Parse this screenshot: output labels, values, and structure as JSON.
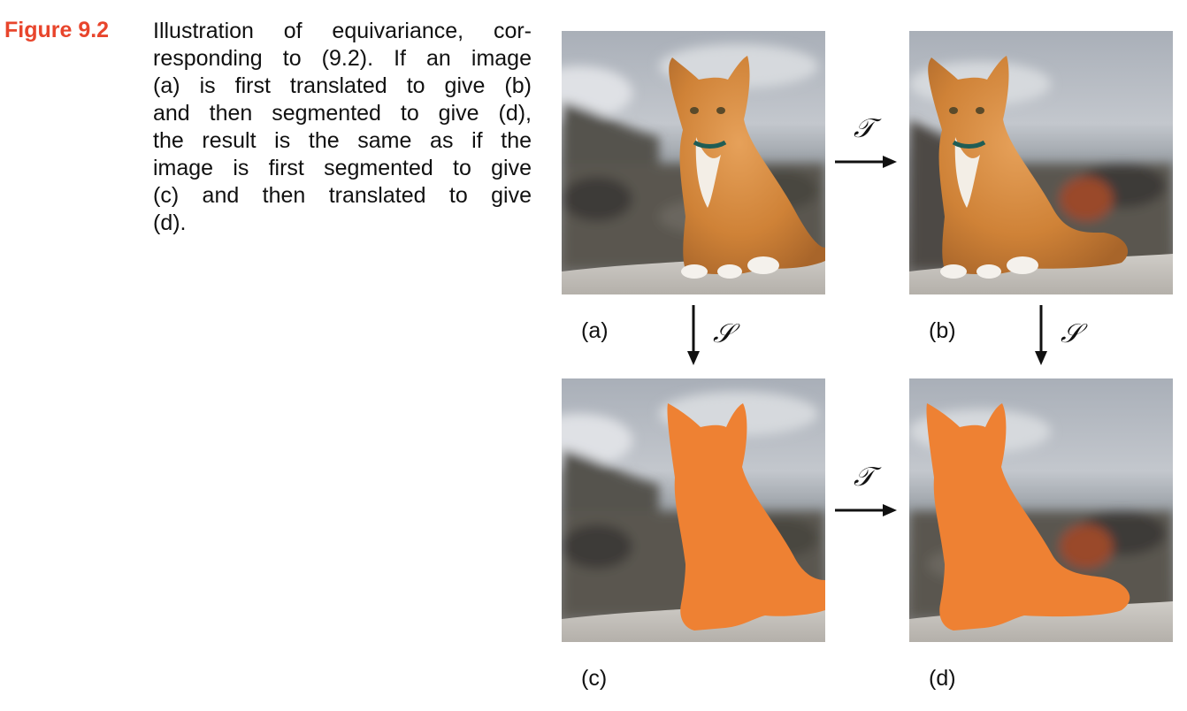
{
  "figure": {
    "label": "Figure 9.2",
    "caption_lines": [
      "Illustration of equivariance, cor-",
      "responding to (9.2). If an image",
      "(a) is first translated to give (b)",
      "and then segmented to give (d),",
      "the result is the same as if the",
      "image is first segmented to give",
      "(c) and then translated to give",
      "(d)."
    ]
  },
  "panels": {
    "a": "(a)",
    "b": "(b)",
    "c": "(c)",
    "d": "(d)"
  },
  "operators": {
    "translate": "𝒯",
    "segment": "𝒮"
  },
  "colors": {
    "figure_label": "#e8452c",
    "mask": "#ee8133",
    "cat_fur": "#d9893e",
    "sky": "#b7bcc3",
    "rock_ground": "#c9c6c1"
  }
}
